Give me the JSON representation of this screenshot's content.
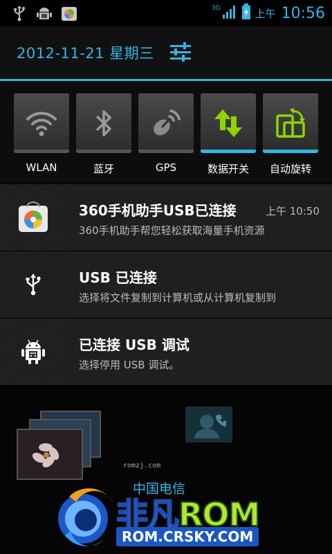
{
  "status_bar": {
    "icons_left": [
      "usb-icon",
      "android-debug-icon",
      "app-360-icon"
    ],
    "network_label": "3G",
    "ampm": "上午",
    "time": "10:56"
  },
  "header": {
    "date": "2012-11-21 星期三",
    "settings_icon": "sliders-icon"
  },
  "toggles": [
    {
      "label": "WLAN",
      "icon": "wifi-icon",
      "on": false
    },
    {
      "label": "蓝牙",
      "icon": "bluetooth-icon",
      "on": false
    },
    {
      "label": "GPS",
      "icon": "gps-icon",
      "on": false
    },
    {
      "label": "数据开关",
      "icon": "data-icon",
      "on": true
    },
    {
      "label": "自动旋转",
      "icon": "rotate-icon",
      "on": true
    }
  ],
  "notifications": [
    {
      "title": "360手机助手USB已连接",
      "text": "360手机助手帮您轻松获取海量手机资源",
      "time": "上午 10:50",
      "icon": "app-360-icon"
    },
    {
      "title": "USB 已连接",
      "text": "选择将文件复制到计算机或从计算机复制到",
      "icon": "usb-icon"
    },
    {
      "title": "已连接 USB 调试",
      "text": "选择停用 USB 调试。",
      "icon": "android-debug-icon"
    }
  ],
  "home": {
    "site_label": "romzj.com",
    "carrier": "中国电信"
  },
  "watermark": {
    "brand_cn": "非凡",
    "brand_rom": "ROM",
    "url": "ROM.CRSKY.COM"
  },
  "colors": {
    "accent": "#33b5e5",
    "toggle_on_icon": "#8fd400"
  }
}
